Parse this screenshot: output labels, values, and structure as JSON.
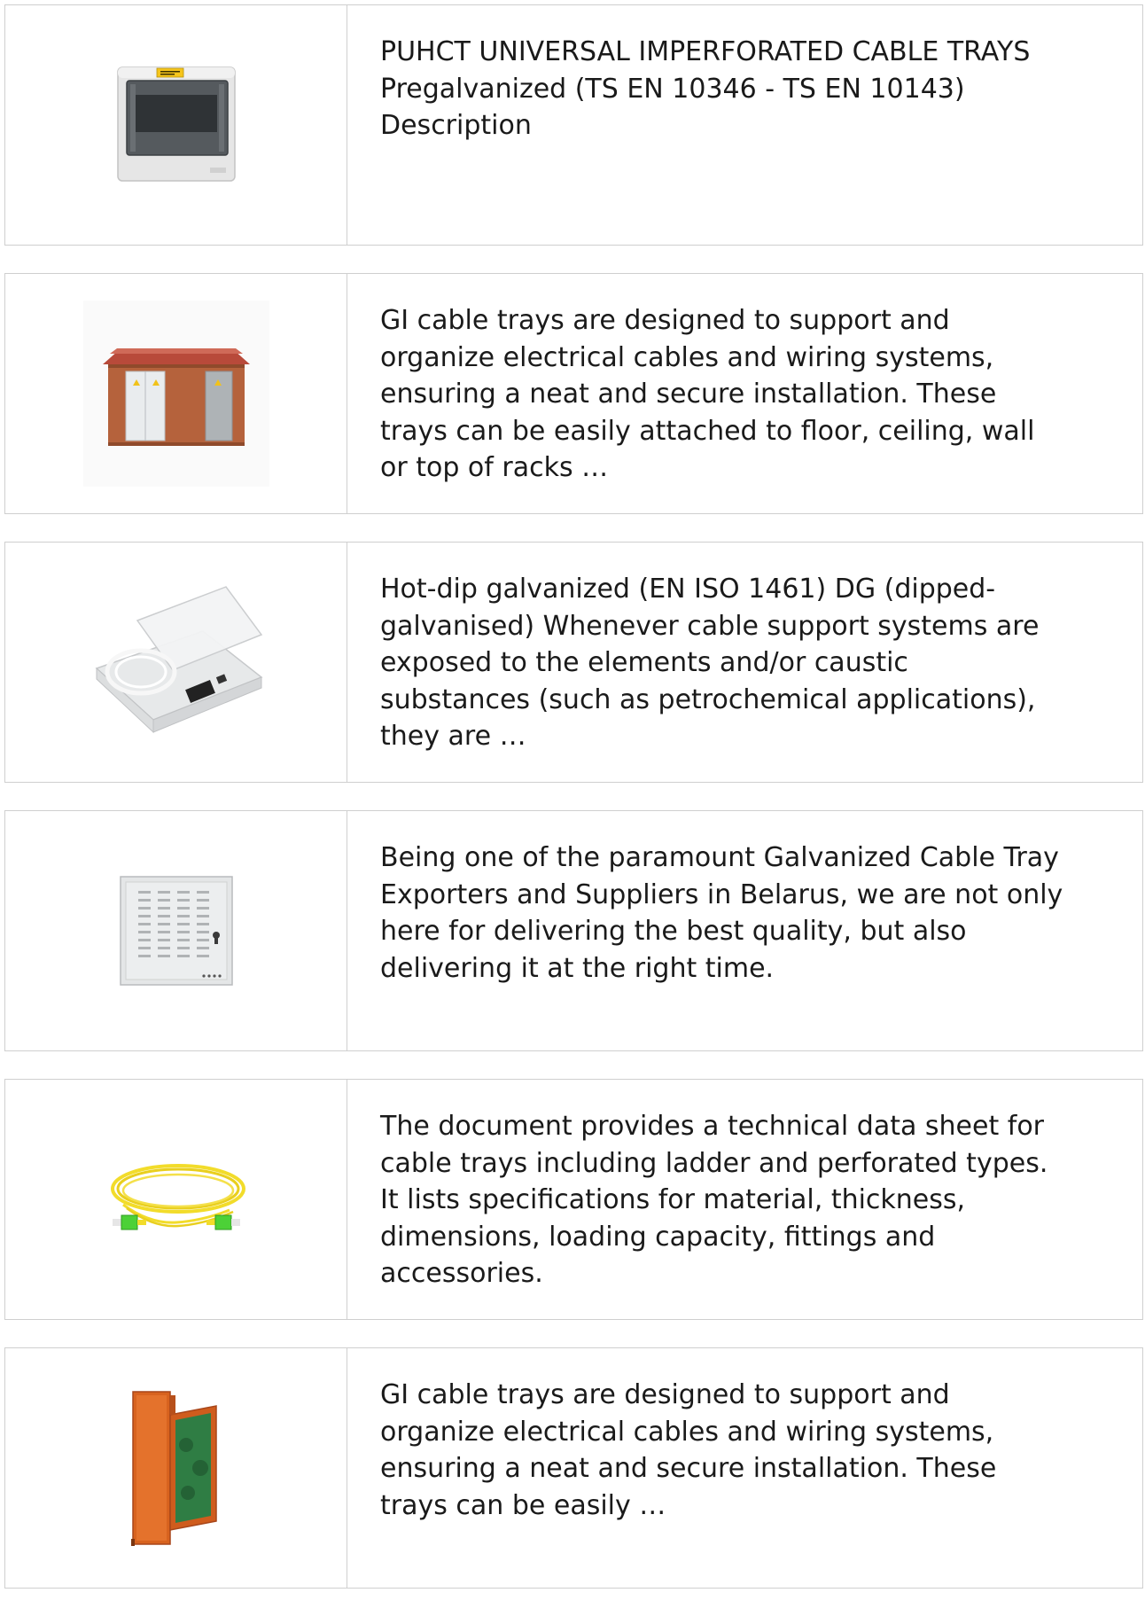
{
  "items": [
    {
      "image": "electrical-distribution-box-image",
      "lines": [
        "PUHCT UNIVERSAL IMPERFORATED CABLE TRAYS",
        "Pregalvanized (TS EN 10346 - TS EN 10143)",
        "Description"
      ]
    },
    {
      "image": "transformer-substation-kiosk-image",
      "lines": [
        "GI cable trays are designed to support and",
        "organize electrical cables and wiring systems,",
        "ensuring a neat and secure installation. These",
        "trays can be easily attached to floor, ceiling, wall",
        "or top of racks …"
      ]
    },
    {
      "image": "fiber-termination-box-image",
      "lines": [
        "Hot-dip galvanized (EN ISO 1461) DG (dipped-",
        "galvanised) Whenever cable support systems are",
        "exposed to the elements and/or caustic",
        "substances (such as petrochemical applications),",
        "they are …"
      ]
    },
    {
      "image": "ventilated-wall-cabinet-image",
      "lines": [
        "Being one of the paramount Galvanized Cable Tray",
        "Exporters and Suppliers in Belarus, we are not only",
        "here for delivering the best quality, but also",
        "delivering it at the right time."
      ]
    },
    {
      "image": "fiber-patch-cord-image",
      "lines": [
        "The document provides a technical data sheet for",
        "cable trays including ladder and perforated types.",
        "It lists specifications for material, thickness,",
        "dimensions, loading capacity, fittings and",
        "accessories."
      ]
    },
    {
      "image": "orange-fiber-splice-box-image",
      "lines": [
        "GI cable trays are designed to support and",
        "organize electrical cables and wiring systems,",
        "ensuring a neat and secure installation. These",
        "trays can be easily …"
      ]
    }
  ]
}
